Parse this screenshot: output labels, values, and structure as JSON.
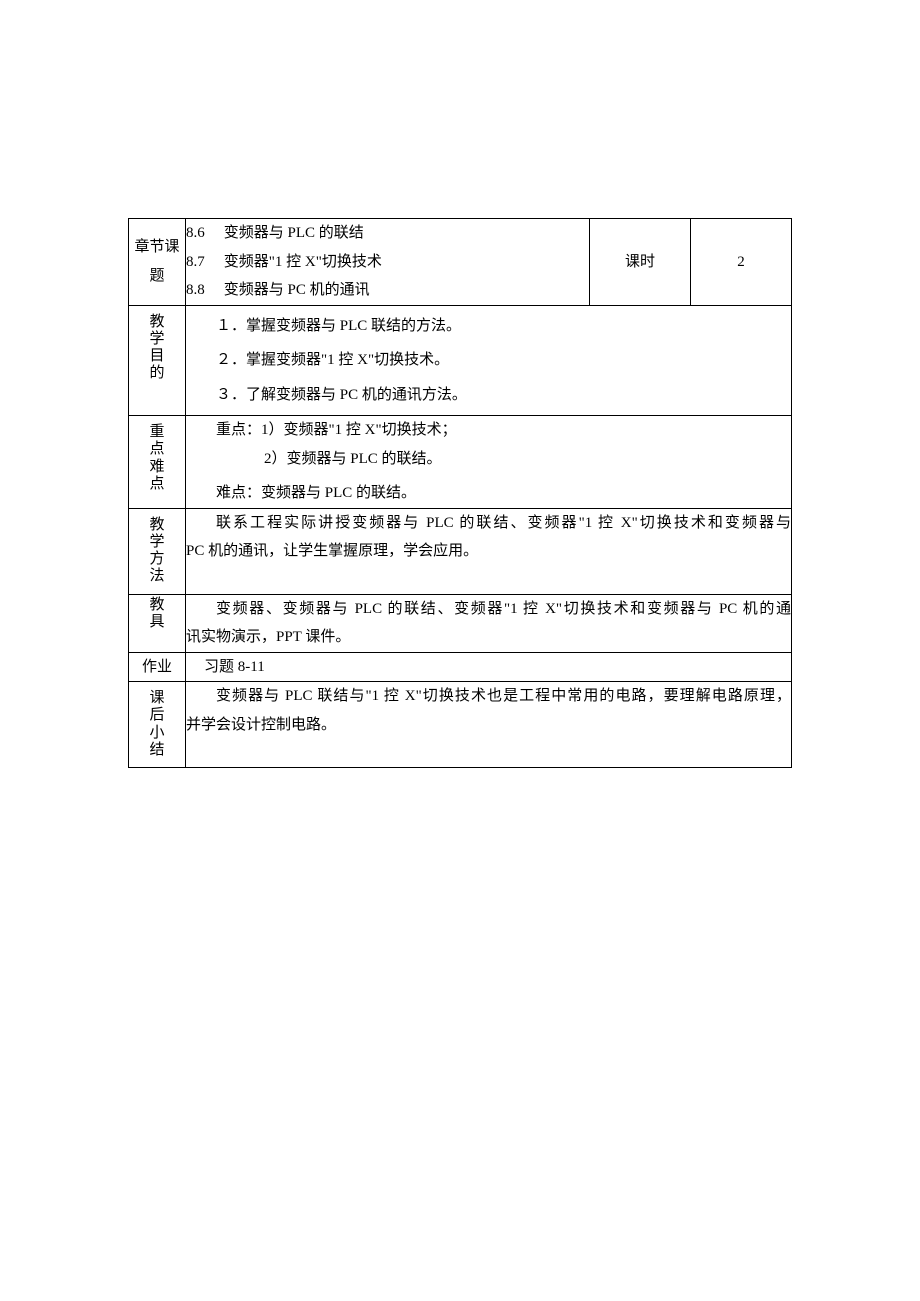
{
  "header": {
    "chapter_topic_label": "章节课题",
    "topics": [
      {
        "num": "8.6",
        "title": "变频器与 PLC 的联结"
      },
      {
        "num": "8.7",
        "title": "变频器\"1 控 X\"切换技术"
      },
      {
        "num": "8.8",
        "title": "变频器与 PC 机的通讯"
      }
    ],
    "hours_label": "课时",
    "hours_value": "2"
  },
  "objectives": {
    "label": "教学目的",
    "items": [
      "１．掌握变频器与 PLC 联结的方法。",
      "２．掌握变频器\"1 控 X\"切换技术。",
      "３．了解变频器与 PC 机的通讯方法。"
    ]
  },
  "key_points": {
    "label": "重点难点",
    "key_intro": "重点：1）变频器\"1 控 X\"切换技术；",
    "key_line2": "2）变频器与 PLC 的联结。",
    "diff_intro": "难点：变频器与 PLC 的联结。"
  },
  "method": {
    "label": "教学方法",
    "text_l1": "联系工程实际讲授变频器与 PLC 的联结、变频器\"1 控 X\"切换技术和变频器与",
    "text_l2": "PC 机的通讯，让学生掌握原理，学会应用。"
  },
  "tools": {
    "label": "教具",
    "text_l1": "变频器、变频器与 PLC 的联结、变频器\"1 控 X\"切换技术和变频器与 PC 机的通",
    "text_l2": "讯实物演示，PPT 课件。"
  },
  "homework": {
    "label": "作业",
    "text": "习题 8-11"
  },
  "summary": {
    "label": "课后小结",
    "text_l1": "变频器与 PLC 联结与\"1 控 X\"切换技术也是工程中常用的电路，要理解电路原理，",
    "text_l2": "并学会设计控制电路。"
  }
}
